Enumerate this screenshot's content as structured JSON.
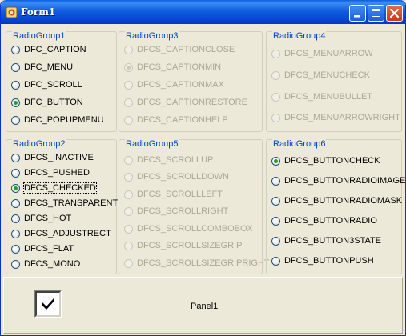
{
  "window": {
    "title": "Form1",
    "controls": [
      "minimize-icon",
      "maximize-icon",
      "close-icon"
    ]
  },
  "groups": [
    {
      "id": "rg1",
      "title": "RadioGroup1",
      "disabled": false,
      "items": [
        {
          "label": "DFC_CAPTION",
          "checked": false
        },
        {
          "label": "DFC_MENU",
          "checked": false
        },
        {
          "label": "DFC_SCROLL",
          "checked": false
        },
        {
          "label": "DFC_BUTTON",
          "checked": true
        },
        {
          "label": "DFC_POPUPMENU",
          "checked": false
        }
      ]
    },
    {
      "id": "rg3",
      "title": "RadioGroup3",
      "disabled": true,
      "items": [
        {
          "label": "DFCS_CAPTIONCLOSE",
          "checked": false
        },
        {
          "label": "DFCS_CAPTIONMIN",
          "checked": true
        },
        {
          "label": "DFCS_CAPTIONMAX",
          "checked": false
        },
        {
          "label": "DFCS_CAPTIONRESTORE",
          "checked": false
        },
        {
          "label": "DFCS_CAPTIONHELP",
          "checked": false
        }
      ]
    },
    {
      "id": "rg4",
      "title": "RadioGroup4",
      "disabled": true,
      "items": [
        {
          "label": "DFCS_MENUARROW",
          "checked": false
        },
        {
          "label": "DFCS_MENUCHECK",
          "checked": false
        },
        {
          "label": "DFCS_MENUBULLET",
          "checked": false
        },
        {
          "label": "DFCS_MENUARROWRIGHT",
          "checked": false
        }
      ]
    },
    {
      "id": "rg2",
      "title": "RadioGroup2",
      "disabled": false,
      "items": [
        {
          "label": "DFCS_INACTIVE",
          "checked": false
        },
        {
          "label": "DFCS_PUSHED",
          "checked": false
        },
        {
          "label": "DFCS_CHECKED",
          "checked": true,
          "focused": true
        },
        {
          "label": "DFCS_TRANSPARENT",
          "checked": false
        },
        {
          "label": "DFCS_HOT",
          "checked": false
        },
        {
          "label": "DFCS_ADJUSTRECT",
          "checked": false
        },
        {
          "label": "DFCS_FLAT",
          "checked": false
        },
        {
          "label": "DFCS_MONO",
          "checked": false
        }
      ]
    },
    {
      "id": "rg5",
      "title": "RadioGroup5",
      "disabled": true,
      "items": [
        {
          "label": "DFCS_SCROLLUP",
          "checked": false
        },
        {
          "label": "DFCS_SCROLLDOWN",
          "checked": false
        },
        {
          "label": "DFCS_SCROLLLEFT",
          "checked": false
        },
        {
          "label": "DFCS_SCROLLRIGHT",
          "checked": false
        },
        {
          "label": "DFCS_SCROLLCOMBOBOX",
          "checked": false
        },
        {
          "label": "DFCS_SCROLLSIZEGRIP",
          "checked": false
        },
        {
          "label": "DFCS_SCROLLSIZEGRIPRIGHT",
          "checked": false
        }
      ]
    },
    {
      "id": "rg6",
      "title": "RadioGroup6",
      "disabled": false,
      "items": [
        {
          "label": "DFCS_BUTTONCHECK",
          "checked": true
        },
        {
          "label": "DFCS_BUTTONRADIOIMAGE",
          "checked": false
        },
        {
          "label": "DFCS_BUTTONRADIOMASK",
          "checked": false
        },
        {
          "label": "DFCS_BUTTONRADIO",
          "checked": false
        },
        {
          "label": "DFCS_BUTTON3STATE",
          "checked": false
        },
        {
          "label": "DFCS_BUTTONPUSH",
          "checked": false
        }
      ]
    }
  ],
  "panel": {
    "caption": "Panel1",
    "checkbox_checked": true
  },
  "colors": {
    "titlebar": "#0a5fe0",
    "group_title": "#0046d5",
    "radio_check": "#21a121",
    "disabled_text": "#aca899",
    "background": "#ece9d8"
  }
}
